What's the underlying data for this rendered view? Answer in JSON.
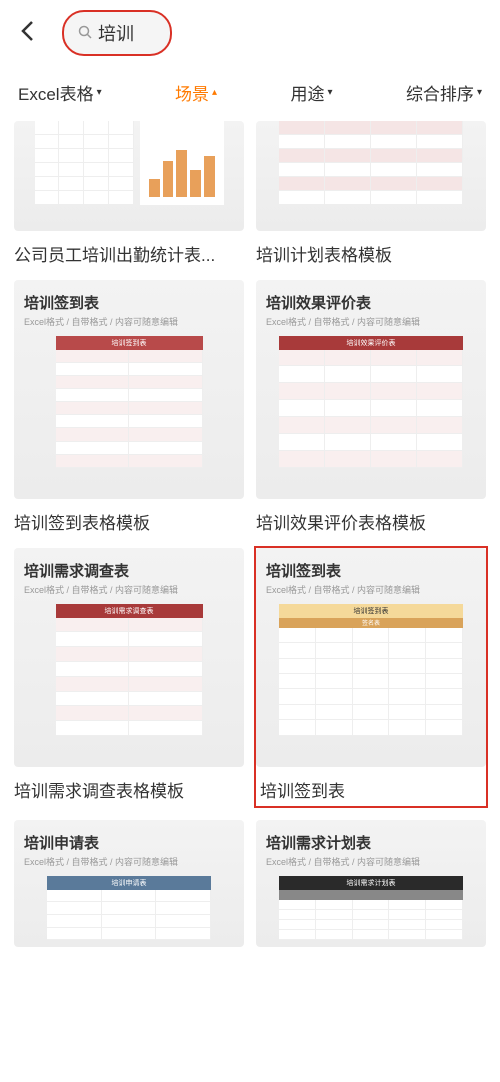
{
  "header": {
    "search_text": "培训"
  },
  "filters": {
    "type": "Excel表格",
    "scene": "场景",
    "purpose": "用途",
    "sort": "综合排序"
  },
  "thumb_sub": "Excel格式 / 自带格式 / 内容可随意编辑",
  "cards": [
    {
      "label": "公司员工培训出勤统计表..."
    },
    {
      "label": "培训计划表格模板"
    },
    {
      "label": "培训签到表格模板",
      "preview_title": "培训签到表",
      "preview_header": "培训签到表"
    },
    {
      "label": "培训效果评价表格模板",
      "preview_title": "培训效果评价表",
      "preview_header": "培训效果评价表"
    },
    {
      "label": "培训需求调查表格模板",
      "preview_title": "培训需求调查表",
      "preview_header": "培训需求调查表"
    },
    {
      "label": "培训签到表",
      "preview_title": "培训签到表",
      "preview_header": "培训签到表",
      "preview_sub": "签名表"
    },
    {
      "label": "",
      "preview_title": "培训申请表",
      "preview_header": "培训申请表"
    },
    {
      "label": "",
      "preview_title": "培训需求计划表",
      "preview_header": "培训需求计划表"
    }
  ]
}
